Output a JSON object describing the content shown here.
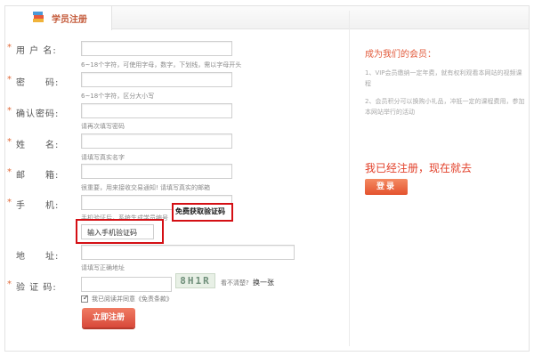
{
  "header": {
    "tab_label": "学员注册",
    "tab_icon": "books-icon"
  },
  "form": {
    "username": {
      "label": "用 户 名:",
      "required": "*",
      "value": "",
      "hint": "6~18个字符，可使用字母，数字，下划线，需以字母开头"
    },
    "password": {
      "label": "密　　码:",
      "required": "*",
      "value": "",
      "hint": "6~18个字符，区分大小写"
    },
    "confirm_password": {
      "label": "确认密码:",
      "required": "*",
      "value": "",
      "hint": "请再次填写密码"
    },
    "name": {
      "label": "姓　　名:",
      "required": "*",
      "value": "",
      "hint": "请填写真实名字"
    },
    "email": {
      "label": "邮　　箱:",
      "required": "*",
      "value": "",
      "hint": "很重要，用来接收交易通知! 请填写真实的邮箱"
    },
    "phone": {
      "label": "手　　机:",
      "required": "*",
      "value": "",
      "hint": "手机验证后，系统生成学员编号"
    },
    "get_code_button": "免费获取验证码",
    "phone_code_placeholder": "输入手机验证码",
    "address": {
      "label": "地　　址:",
      "value": "",
      "hint": "请填写正确地址"
    },
    "captcha": {
      "label": "验 证 码:",
      "required": "*",
      "value": "",
      "image_text": "8H1R",
      "hint": "看不清楚?",
      "refresh": "换一张"
    },
    "agree_text": "我已阅读并同意《免责条款》",
    "agree_checked": true,
    "submit": "立即注册"
  },
  "sidebar": {
    "title": "成为我们的会员：",
    "items": [
      "1、VIP会员缴纳一定年费，就有权利观看本网站的视频课程",
      "2、会员积分可以换购小礼品，冲抵一定的课程费用，参加本网站举行的活动"
    ],
    "cta": "我已经注册，现在就去",
    "login_button": "登录"
  },
  "colors": {
    "accent": "#e25b3c",
    "highlight_border": "#d40f14",
    "button": "#d8493a"
  }
}
